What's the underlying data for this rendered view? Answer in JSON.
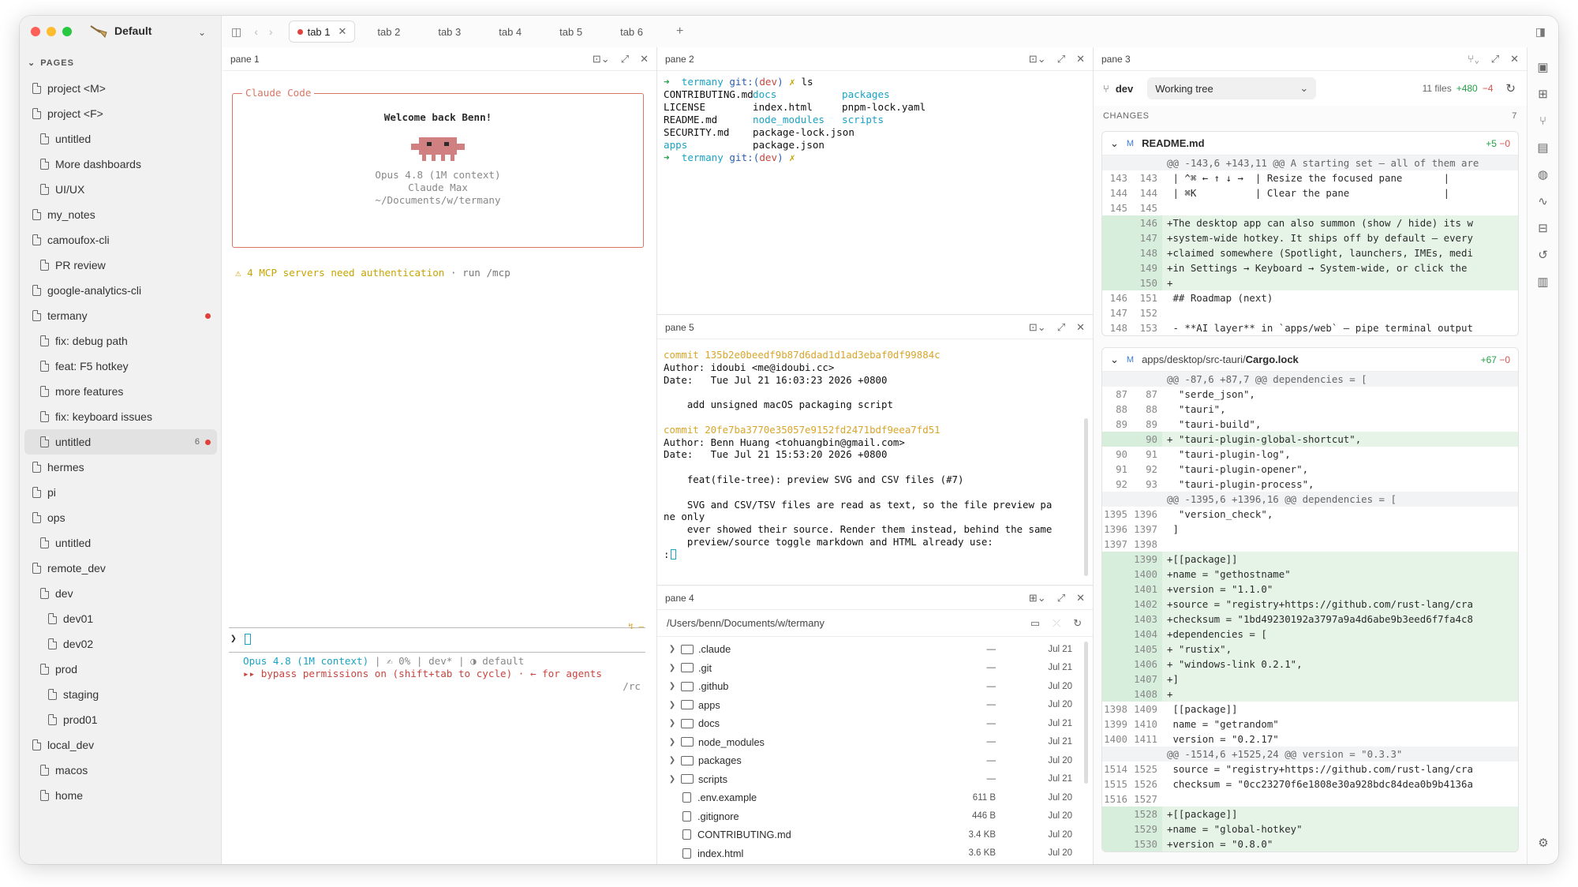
{
  "workspace": {
    "name": "Default"
  },
  "sidebar": {
    "header": "PAGES",
    "items": [
      {
        "label": "project <M>",
        "depth": 0
      },
      {
        "label": "project <F>",
        "depth": 0
      },
      {
        "label": "untitled",
        "depth": 1
      },
      {
        "label": "More dashboards",
        "depth": 1
      },
      {
        "label": "UI/UX",
        "depth": 1
      },
      {
        "label": "my_notes",
        "depth": 0
      },
      {
        "label": "camoufox-cli",
        "depth": 0
      },
      {
        "label": "PR review",
        "depth": 1
      },
      {
        "label": "google-analytics-cli",
        "depth": 0
      },
      {
        "label": "termany",
        "depth": 0,
        "dot": true
      },
      {
        "label": "fix: debug path",
        "depth": 1
      },
      {
        "label": "feat: F5 hotkey",
        "depth": 1
      },
      {
        "label": "more features",
        "depth": 1
      },
      {
        "label": "fix: keyboard issues",
        "depth": 1
      },
      {
        "label": "untitled",
        "depth": 1,
        "active": true,
        "count": "6",
        "dot": true
      },
      {
        "label": "hermes",
        "depth": 0
      },
      {
        "label": "pi",
        "depth": 0
      },
      {
        "label": "ops",
        "depth": 0
      },
      {
        "label": "untitled",
        "depth": 1
      },
      {
        "label": "remote_dev",
        "depth": 0
      },
      {
        "label": "dev",
        "depth": 1
      },
      {
        "label": "dev01",
        "depth": 2
      },
      {
        "label": "dev02",
        "depth": 2
      },
      {
        "label": "prod",
        "depth": 1
      },
      {
        "label": "staging",
        "depth": 2
      },
      {
        "label": "prod01",
        "depth": 2
      },
      {
        "label": "local_dev",
        "depth": 0
      },
      {
        "label": "macos",
        "depth": 1
      },
      {
        "label": "home",
        "depth": 1
      }
    ]
  },
  "tabs": [
    "tab 1",
    "tab 2",
    "tab 3",
    "tab 4",
    "tab 5",
    "tab 6"
  ],
  "pane1": {
    "title": "pane 1",
    "box_title": "Claude Code",
    "welcome": "Welcome back Benn!",
    "model": "Opus 4.8 (1M context)",
    "plan": "Claude Max",
    "cwd": "~/Documents/w/termany",
    "warning": "⚠ 4 MCP servers need authentication · run /mcp",
    "prompt": "❯",
    "status1a": "Opus 4.8 (1M context)",
    "status1b": "| ✍ 0% | dev* | ◑ default",
    "status2": "▸▸ bypass permissions on (shift+tab to cycle) · ← for agents",
    "status3": "/rc"
  },
  "pane2": {
    "title": "pane 2",
    "prompt_dir": "termany",
    "prompt_git": "git:(dev)",
    "cmd": "ls",
    "ls": [
      [
        "CONTRIBUTING.md",
        "docs",
        "packages"
      ],
      [
        "LICENSE",
        "index.html",
        "pnpm-lock.yaml"
      ],
      [
        "README.md",
        "node_modules",
        "scripts"
      ],
      [
        "SECURITY.md",
        "package-lock.json",
        ""
      ],
      [
        "apps",
        "package.json",
        ""
      ]
    ]
  },
  "pane5": {
    "title": "pane 5",
    "commits": [
      {
        "hash": "commit 135b2e0beedf9b87d6dad1d1ad3ebaf0df99884c",
        "author": "Author: idoubi <me@idoubi.cc>",
        "date": "Date:   Tue Jul 21 16:03:23 2026 +0800",
        "msg": [
          "    add unsigned macOS packaging script"
        ]
      },
      {
        "hash": "commit 20fe7ba3770e35057e9152fd2471bdf9eea7fd51",
        "author": "Author: Benn Huang <tohuangbin@gmail.com>",
        "date": "Date:   Tue Jul 21 15:53:20 2026 +0800",
        "msg": [
          "    feat(file-tree): preview SVG and CSV files (#7)",
          "",
          "    SVG and CSV/TSV files are read as text, so the file preview pa",
          "ne only",
          "    ever showed their source. Render them instead, behind the same",
          "    preview/source toggle markdown and HTML already use:"
        ]
      }
    ],
    "pager": ":"
  },
  "pane4": {
    "title": "pane 4",
    "path": "/Users/benn/Documents/w/termany",
    "rows": [
      {
        "name": ".claude",
        "type": "dir",
        "size": "—",
        "date": "Jul 21"
      },
      {
        "name": ".git",
        "type": "dir",
        "size": "—",
        "date": "Jul 21"
      },
      {
        "name": ".github",
        "type": "dir",
        "size": "—",
        "date": "Jul 20"
      },
      {
        "name": "apps",
        "type": "dir",
        "size": "—",
        "date": "Jul 20"
      },
      {
        "name": "docs",
        "type": "dir",
        "size": "—",
        "date": "Jul 21"
      },
      {
        "name": "node_modules",
        "type": "dir",
        "size": "—",
        "date": "Jul 21"
      },
      {
        "name": "packages",
        "type": "dir",
        "size": "—",
        "date": "Jul 20"
      },
      {
        "name": "scripts",
        "type": "dir",
        "size": "—",
        "date": "Jul 21"
      },
      {
        "name": ".env.example",
        "type": "file",
        "size": "611 B",
        "date": "Jul 20"
      },
      {
        "name": ".gitignore",
        "type": "file",
        "size": "446 B",
        "date": "Jul 20"
      },
      {
        "name": "CONTRIBUTING.md",
        "type": "file",
        "size": "3.4 KB",
        "date": "Jul 20"
      },
      {
        "name": "index.html",
        "type": "file",
        "size": "3.6 KB",
        "date": "Jul 20"
      }
    ]
  },
  "pane3": {
    "title": "pane 3",
    "branch": "dev",
    "select": "Working tree",
    "files": "11 files",
    "adds": "+480",
    "dels": "−4",
    "changes_label": "CHANGES",
    "changes_count": "7",
    "file1": {
      "badge": "M",
      "name": "README.md",
      "stat_add": "+5",
      "stat_del": "−0",
      "lines": [
        {
          "k": "hunk",
          "t": "@@ -143,6 +143,11 @@ A starting set — all of them are"
        },
        {
          "a": "143",
          "b": "143",
          "t": " | ^⌘ ← ↑ ↓ →  | Resize the focused pane       |"
        },
        {
          "a": "144",
          "b": "144",
          "t": " | ⌘K          | Clear the pane                |"
        },
        {
          "a": "145",
          "b": "145",
          "t": ""
        },
        {
          "k": "add",
          "b": "146",
          "t": "+The desktop app can also summon (show / hide) its w"
        },
        {
          "k": "add",
          "b": "147",
          "t": "+system-wide hotkey. It ships off by default — every"
        },
        {
          "k": "add",
          "b": "148",
          "t": "+claimed somewhere (Spotlight, launchers, IMEs, medi"
        },
        {
          "k": "add",
          "b": "149",
          "t": "+in Settings → Keyboard → System-wide, or click the"
        },
        {
          "k": "add",
          "b": "150",
          "t": "+"
        },
        {
          "a": "146",
          "b": "151",
          "t": " ## Roadmap (next)"
        },
        {
          "a": "147",
          "b": "152",
          "t": ""
        },
        {
          "a": "148",
          "b": "153",
          "t": " - **AI layer** in `apps/web` — pipe terminal output"
        }
      ]
    },
    "file2": {
      "badge": "M",
      "path": "apps/desktop/src-tauri/",
      "name": "Cargo.lock",
      "stat_add": "+67",
      "stat_del": "−0",
      "lines": [
        {
          "k": "hunk",
          "t": "@@ -87,6 +87,7 @@ dependencies = ["
        },
        {
          "a": "87",
          "b": "87",
          "t": "  \"serde_json\","
        },
        {
          "a": "88",
          "b": "88",
          "t": "  \"tauri\","
        },
        {
          "a": "89",
          "b": "89",
          "t": "  \"tauri-build\","
        },
        {
          "k": "add",
          "b": "90",
          "t": "+ \"tauri-plugin-global-shortcut\","
        },
        {
          "a": "90",
          "b": "91",
          "t": "  \"tauri-plugin-log\","
        },
        {
          "a": "91",
          "b": "92",
          "t": "  \"tauri-plugin-opener\","
        },
        {
          "a": "92",
          "b": "93",
          "t": "  \"tauri-plugin-process\","
        },
        {
          "k": "hunk",
          "t": "@@ -1395,6 +1396,16 @@ dependencies = ["
        },
        {
          "a": "1395",
          "b": "1396",
          "t": "  \"version_check\","
        },
        {
          "a": "1396",
          "b": "1397",
          "t": " ]"
        },
        {
          "a": "1397",
          "b": "1398",
          "t": ""
        },
        {
          "k": "add",
          "b": "1399",
          "t": "+[[package]]"
        },
        {
          "k": "add",
          "b": "1400",
          "t": "+name = \"gethostname\""
        },
        {
          "k": "add",
          "b": "1401",
          "t": "+version = \"1.1.0\""
        },
        {
          "k": "add",
          "b": "1402",
          "t": "+source = \"registry+https://github.com/rust-lang/cra"
        },
        {
          "k": "add",
          "b": "1403",
          "t": "+checksum = \"1bd49230192a3797a9a4d6abe9b3eed6f7fa4c8"
        },
        {
          "k": "add",
          "b": "1404",
          "t": "+dependencies = ["
        },
        {
          "k": "add",
          "b": "1405",
          "t": "+ \"rustix\","
        },
        {
          "k": "add",
          "b": "1406",
          "t": "+ \"windows-link 0.2.1\","
        },
        {
          "k": "add",
          "b": "1407",
          "t": "+]"
        },
        {
          "k": "add",
          "b": "1408",
          "t": "+"
        },
        {
          "a": "1398",
          "b": "1409",
          "t": " [[package]]"
        },
        {
          "a": "1399",
          "b": "1410",
          "t": " name = \"getrandom\""
        },
        {
          "a": "1400",
          "b": "1411",
          "t": " version = \"0.2.17\""
        },
        {
          "k": "hunk",
          "t": "@@ -1514,6 +1525,24 @@ version = \"0.3.3\""
        },
        {
          "a": "1514",
          "b": "1525",
          "t": " source = \"registry+https://github.com/rust-lang/cra"
        },
        {
          "a": "1515",
          "b": "1526",
          "t": " checksum = \"0cc23270f6e1808e30a928bdc84dea0b9b4136a"
        },
        {
          "a": "1516",
          "b": "1527",
          "t": ""
        },
        {
          "k": "add",
          "b": "1528",
          "t": "+[[package]]"
        },
        {
          "k": "add",
          "b": "1529",
          "t": "+name = \"global-hotkey\""
        },
        {
          "k": "add",
          "b": "1530",
          "t": "+version = \"0.8.0\""
        }
      ]
    }
  }
}
